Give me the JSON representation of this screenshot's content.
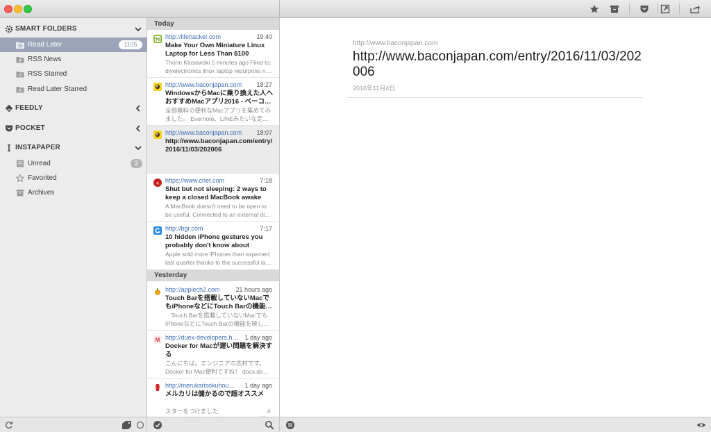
{
  "toolbar": {
    "star_icon": "star-icon",
    "archive_icon": "archive-icon",
    "pocket_icon": "pocket-icon",
    "external_icon": "open-external-icon",
    "share_icon": "share-icon"
  },
  "sidebar": {
    "smart_folders": {
      "label": "SMART FOLDERS",
      "items": [
        {
          "label": "Read Later",
          "badge": "1105"
        },
        {
          "label": "RSS News"
        },
        {
          "label": "RSS Starred"
        },
        {
          "label": "Read Later Starred"
        }
      ]
    },
    "feedly": {
      "label": "FEEDLY"
    },
    "pocket": {
      "label": "POCKET"
    },
    "instapaper": {
      "label": "INSTAPAPER",
      "items": [
        {
          "label": "Unread",
          "badge": "2"
        },
        {
          "label": "Favorited"
        },
        {
          "label": "Archives"
        }
      ]
    }
  },
  "list": {
    "today_label": "Today",
    "yesterday_label": "Yesterday",
    "articles": [
      {
        "source": "http://lifehacker.com",
        "time": "19:40",
        "title": "Make Your Own Miniature Linux Laptop for Less Than $100",
        "summary": "Thorin Klosowski 5 minutes ago Filed to: diyelectronics linux laptop repurpose n…"
      },
      {
        "source": "http://www.baconjapan.com",
        "time": "18:27",
        "title": "WindowsからMacに乗り換えた人へおすすめMacアプリ2016 - ベーコ…",
        "summary": "全部無料の便利なMacアプリを集めてみました。 Evernote、LINEみたいな定…"
      },
      {
        "source": "http://www.baconjapan.com",
        "time": "18:07",
        "title": "http://www.baconjapan.com/entry/2016/11/03/202006",
        "summary": ""
      },
      {
        "source": "https://www.cnet.com",
        "time": "7:18",
        "title": "Shut but not sleeping: 2 ways to keep a closed MacBook awake",
        "summary": "A MacBook doesn't need to be open to be useful. Connected to an external di…"
      },
      {
        "source": "http://bgr.com",
        "time": "7:17",
        "title": "10 hidden iPhone gestures you probably don't know about",
        "summary": "Apple sold more iPhones than expected last quarter thanks to the successful la…"
      },
      {
        "source": "http://applech2.com",
        "time": "21 hours ago",
        "title": "Touch Barを搭載していないMacでもiPhoneなどにTouch Barの機能…",
        "summary": "　Touch Barを搭載していないMacでもiPhoneなどにTouch Barの機能を映し…"
      },
      {
        "source": "http://duex-developers.h…",
        "time": "1 day ago",
        "title": "Docker for Macが遅い問題を解決する",
        "summary": "こんにちは。エンジニアの志村です。Docker for Mac便利ですね！ docs.do…"
      },
      {
        "source": "http://merukarisokuhou…",
        "time": "1 day ago",
        "title": "メルカリは儲かるので超オススメ",
        "summary": "スターをつけました　　　　　　　　メルカリは儲かるので超オススメ　最近メル…"
      }
    ]
  },
  "reader": {
    "source": "http://www.baconjapan.com",
    "title": "http://www.baconjapan.com/entry/2016/11/03/202006",
    "date": "2016年11月4日"
  },
  "colors": {
    "active_row": "#9ba4b9",
    "link_blue": "#3f6fb7"
  }
}
